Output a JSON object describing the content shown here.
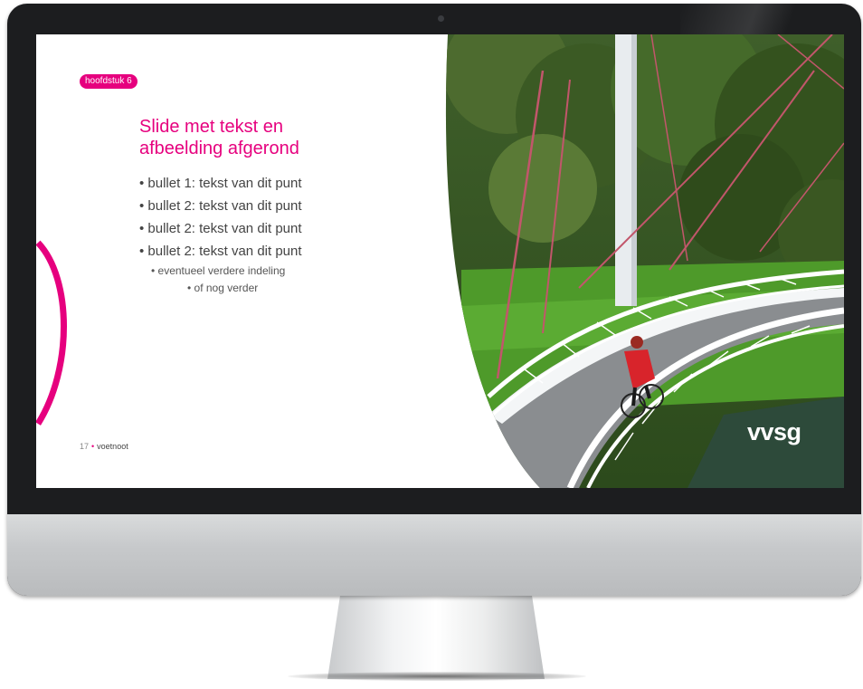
{
  "slide": {
    "chapter_badge": "hoofdstuk 6",
    "title": "Slide met tekst en afbeelding afgerond",
    "bullets": [
      {
        "text": "• bullet 1: tekst van dit punt",
        "level": 1
      },
      {
        "text": "• bullet 2: tekst van dit punt",
        "level": 1
      },
      {
        "text": "• bullet 2: tekst van dit punt",
        "level": 1
      },
      {
        "text": "• bullet 2: tekst van dit punt",
        "level": 1
      },
      {
        "text": "• eventueel verdere indeling",
        "level": 2
      },
      {
        "text": "• of nog verder",
        "level": 3
      }
    ],
    "footer": {
      "page_number": "17",
      "separator": "•",
      "note": "voetnoot"
    },
    "logo_text": "vvsg",
    "image_icon": "bridge-cyclist-photo"
  },
  "colors": {
    "accent": "#e6007e",
    "monitor_frame": "#1c1d1f",
    "chin": "#c7c9cb"
  }
}
